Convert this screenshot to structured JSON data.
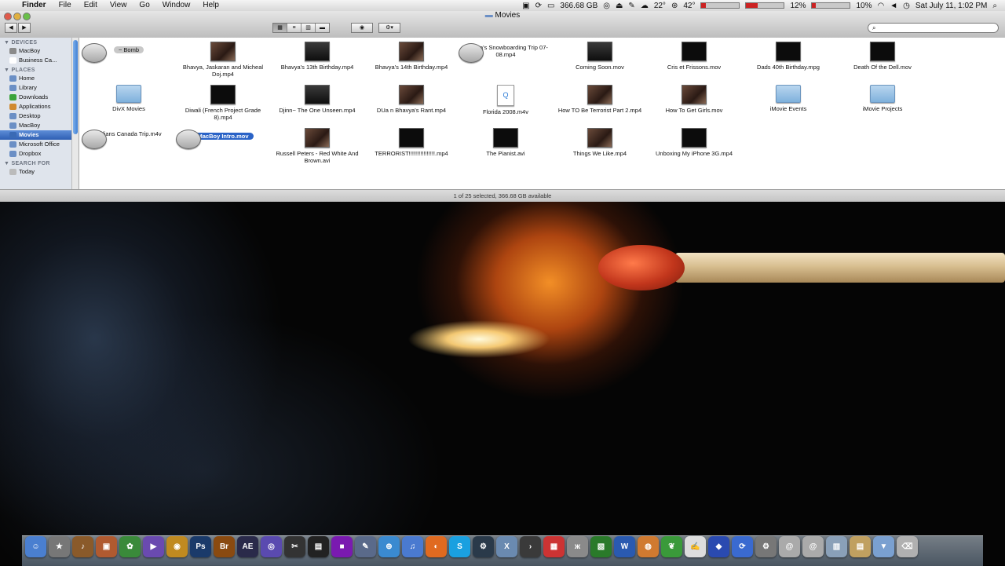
{
  "menubar": {
    "app_name": "Finder",
    "menus": [
      "File",
      "Edit",
      "View",
      "Go",
      "Window",
      "Help"
    ],
    "status": {
      "disk": "366.68 GB",
      "temperature": "22°",
      "cpu_temp": "42°",
      "meter1": "12%",
      "meter1_level": 0.12,
      "meter2": "10%",
      "meter2_level": 0.1,
      "clock": "Sat July 11, 1:02 PM"
    }
  },
  "window": {
    "title": "Movies",
    "view_modes": [
      "icon",
      "list",
      "column",
      "coverflow"
    ],
    "active_view": "icon"
  },
  "sidebar": {
    "sections": [
      {
        "title": "DEVICES",
        "items": [
          {
            "label": "MacBoy",
            "icon": "hard-drive-icon",
            "color": "#8a8a8a"
          },
          {
            "label": "Business Ca...",
            "icon": "disk-icon",
            "color": "#ffffff"
          }
        ]
      },
      {
        "title": "PLACES",
        "items": [
          {
            "label": "Home",
            "icon": "home-icon",
            "color": "#6b8fc5"
          },
          {
            "label": "Library",
            "icon": "folder-icon",
            "color": "#6b8fc5"
          },
          {
            "label": "Downloads",
            "icon": "downloads-icon",
            "color": "#3aa33a"
          },
          {
            "label": "Applications",
            "icon": "applications-icon",
            "color": "#d08a30"
          },
          {
            "label": "Desktop",
            "icon": "desktop-icon",
            "color": "#6b8fc5"
          },
          {
            "label": "MacBoy",
            "icon": "folder-icon",
            "color": "#6b8fc5"
          },
          {
            "label": "Movies",
            "icon": "movies-icon",
            "color": "#3a6ab5",
            "selected": true
          },
          {
            "label": "Microsoft Office",
            "icon": "folder-icon",
            "color": "#6b8fc5"
          },
          {
            "label": "Dropbox",
            "icon": "dropbox-icon",
            "color": "#6b8fc5"
          }
        ]
      },
      {
        "title": "SEARCH FOR",
        "items": [
          {
            "label": "Today",
            "icon": "clock-icon",
            "color": "#bbbbbb"
          }
        ]
      }
    ]
  },
  "files": [
    {
      "name": "~ Bomb",
      "kind": "light",
      "tag": true
    },
    {
      "name": "Bhavya, Jaskaran and Micheal Doj.mp4",
      "kind": "pic"
    },
    {
      "name": "Bhavya's 13th Birthday.mp4",
      "kind": "dim"
    },
    {
      "name": "Bhavya's 14th Birthday.mp4",
      "kind": "pic"
    },
    {
      "name": "Bhavya's Snowboarding Trip 07-08.mp4",
      "kind": "light"
    },
    {
      "name": "Coming Soon.mov",
      "kind": "dim"
    },
    {
      "name": "Cris et Frissons.mov",
      "kind": "video"
    },
    {
      "name": "Dads 40th Birthday.mpg",
      "kind": "video"
    },
    {
      "name": "Death Of the Dell.mov",
      "kind": "video"
    },
    {
      "name": "DivX Movies",
      "kind": "folder"
    },
    {
      "name": "Diwali (French Project Grade 8).mp4",
      "kind": "video"
    },
    {
      "name": "Djinn~ The One Unseen.mp4",
      "kind": "dim"
    },
    {
      "name": "DUa n Bhavya's Rant.mp4",
      "kind": "pic"
    },
    {
      "name": "Florida 2008.m4v",
      "kind": "doc"
    },
    {
      "name": "How TO Be Terrorist Part 2.mp4",
      "kind": "pic"
    },
    {
      "name": "How To Get Girls.mov",
      "kind": "pic"
    },
    {
      "name": "iMovie Events",
      "kind": "folder"
    },
    {
      "name": "iMovie Projects",
      "kind": "folder"
    },
    {
      "name": "Indians Canada Trip.m4v",
      "kind": "light"
    },
    {
      "name": "MacBoy Intro.mov",
      "kind": "light",
      "selected": true
    },
    {
      "name": "Russell Peters - Red White And Brown.avi",
      "kind": "pic"
    },
    {
      "name": "TERRORIST!!!!!!!!!!!!!!!!.mp4",
      "kind": "video"
    },
    {
      "name": "The Pianist.avi",
      "kind": "video"
    },
    {
      "name": "Things We Like.mp4",
      "kind": "pic"
    },
    {
      "name": "Unboxing My iPhone 3G.mp4",
      "kind": "video"
    }
  ],
  "statusbar": {
    "text": "1 of 25 selected, 366.68 GB available"
  },
  "dock": [
    {
      "name": "finder-icon",
      "color": "#4a7fd0",
      "glyph": "☺"
    },
    {
      "name": "imovie-star-icon",
      "color": "#777777",
      "glyph": "★"
    },
    {
      "name": "garageband-icon",
      "color": "#8a5a2a",
      "glyph": "♪"
    },
    {
      "name": "preview-icon",
      "color": "#b05a30",
      "glyph": "▣"
    },
    {
      "name": "iphoto-icon",
      "color": "#3a8a3a",
      "glyph": "✿"
    },
    {
      "name": "imovie-icon",
      "color": "#6a4ab0",
      "glyph": "▶"
    },
    {
      "name": "photo-booth-icon",
      "color": "#c08a20",
      "glyph": "◉"
    },
    {
      "name": "photoshop-icon",
      "color": "#1a3a6a",
      "glyph": "Ps"
    },
    {
      "name": "bridge-icon",
      "color": "#8a4a10",
      "glyph": "Br"
    },
    {
      "name": "after-effects-icon",
      "color": "#2a2a4a",
      "glyph": "AE"
    },
    {
      "name": "itunes-visualizer-icon",
      "color": "#5a4ab0",
      "glyph": "◎"
    },
    {
      "name": "final-cut-icon",
      "color": "#333333",
      "glyph": "✂"
    },
    {
      "name": "clapper-icon",
      "color": "#222222",
      "glyph": "▤"
    },
    {
      "name": "purple-app-icon",
      "color": "#7a1ab0",
      "glyph": "■"
    },
    {
      "name": "pen-app-icon",
      "color": "#5a6a8a",
      "glyph": "✎"
    },
    {
      "name": "safari-icon",
      "color": "#3a8ad0",
      "glyph": "⊕"
    },
    {
      "name": "itunes-icon",
      "color": "#4a7ad0",
      "glyph": "♫"
    },
    {
      "name": "firefox-icon",
      "color": "#e06a20",
      "glyph": "◐"
    },
    {
      "name": "skype-icon",
      "color": "#1aa0e0",
      "glyph": "S"
    },
    {
      "name": "steam-icon",
      "color": "#2a3a4a",
      "glyph": "⚙"
    },
    {
      "name": "x11-icon",
      "color": "#6a8ab0",
      "glyph": "X"
    },
    {
      "name": "terminal-icon",
      "color": "#3a3a3a",
      "glyph": "›"
    },
    {
      "name": "ical-icon",
      "color": "#cc3333",
      "glyph": "▦"
    },
    {
      "name": "bunny-icon",
      "color": "#8a8a8a",
      "glyph": "ж"
    },
    {
      "name": "photo-frame-icon",
      "color": "#2a7a2a",
      "glyph": "▧"
    },
    {
      "name": "word-icon",
      "color": "#2a5ab0",
      "glyph": "W"
    },
    {
      "name": "octopus-icon",
      "color": "#d07a30",
      "glyph": "◍"
    },
    {
      "name": "leaf-icon",
      "color": "#3a9a3a",
      "glyph": "❦"
    },
    {
      "name": "textedit-icon",
      "color": "#dddddd",
      "glyph": "✍"
    },
    {
      "name": "vpn-icon",
      "color": "#2a4ab0",
      "glyph": "◆"
    },
    {
      "name": "sync-icon",
      "color": "#3a6ad0",
      "glyph": "⟳"
    },
    {
      "name": "system-preferences-icon",
      "color": "#777777",
      "glyph": "⚙"
    },
    {
      "name": "mail-icon",
      "color": "#aaaaaa",
      "glyph": "@"
    },
    {
      "name": "mail2-icon",
      "color": "#aaaaaa",
      "glyph": "@"
    },
    {
      "name": "applications-stack-icon",
      "color": "#8aa0b8",
      "glyph": "▥"
    },
    {
      "name": "documents-stack-icon",
      "color": "#c0a060",
      "glyph": "▤"
    },
    {
      "name": "downloads-stack-icon",
      "color": "#7aa0d0",
      "glyph": "▼"
    },
    {
      "name": "trash-icon",
      "color": "#b0b0b0",
      "glyph": "⌫"
    }
  ]
}
